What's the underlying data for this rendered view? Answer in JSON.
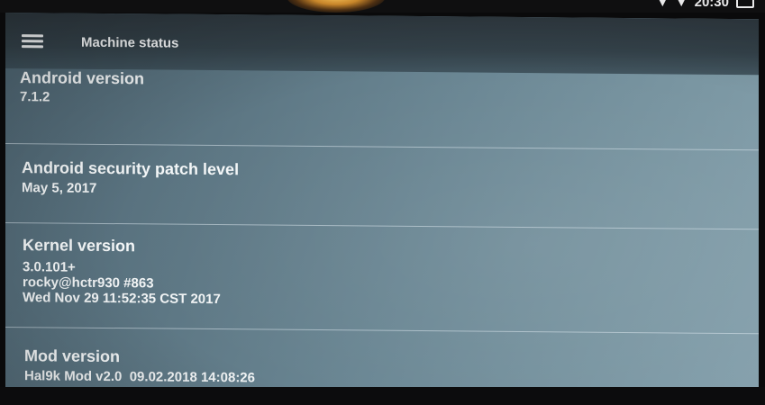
{
  "status_bar": {
    "time": "20:30",
    "icons": [
      "signal-icon",
      "wifi-icon",
      "battery-icon"
    ]
  },
  "app_bar": {
    "menu_icon": "hamburger-menu-icon",
    "title": "Machine status"
  },
  "preferences": [
    {
      "title": "Android version",
      "summary": [
        "7.1.2"
      ]
    },
    {
      "title": "Android security patch level",
      "summary": [
        "May 5, 2017"
      ]
    },
    {
      "title": "Kernel version",
      "summary": [
        "3.0.101+",
        "rocky@hctr930 #863",
        "Wed Nov 29 11:52:35 CST 2017"
      ]
    },
    {
      "title": "Mod version",
      "summary": [
        "Hal9k Mod v2.0  09.02.2018 14:08:26"
      ]
    }
  ],
  "colors": {
    "screen_background": "#6b8794",
    "app_bar": "#34424a",
    "text": "#f3f6f7"
  }
}
